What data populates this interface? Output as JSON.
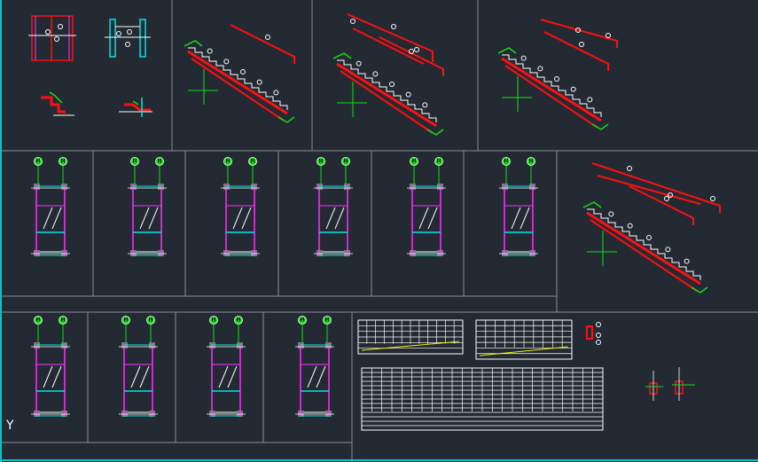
{
  "viewport": {
    "background": "#232a33",
    "frame_color": "#8a8f96",
    "crosshair_color": "#00c8c8",
    "ucs_label": "Y"
  },
  "colors": {
    "rail_red": "#ff1010",
    "stair_white": "#ffffff",
    "green": "#10e010",
    "cyan": "#00e5e5",
    "magenta": "#ff30ff",
    "yellow": "#f0f000",
    "gray_block": "#7a7a7a"
  },
  "grid_bubbles": {
    "row1_labels": [
      "H",
      "H"
    ],
    "row2_labels": [
      "H",
      "H"
    ]
  },
  "panels": {
    "row1_count": 4,
    "row2_plan_count": 6,
    "row3_plan_count": 4
  },
  "icons": [
    "stair-section-icon",
    "stair-plan-icon",
    "schedule-table-icon",
    "ucs-icon"
  ]
}
